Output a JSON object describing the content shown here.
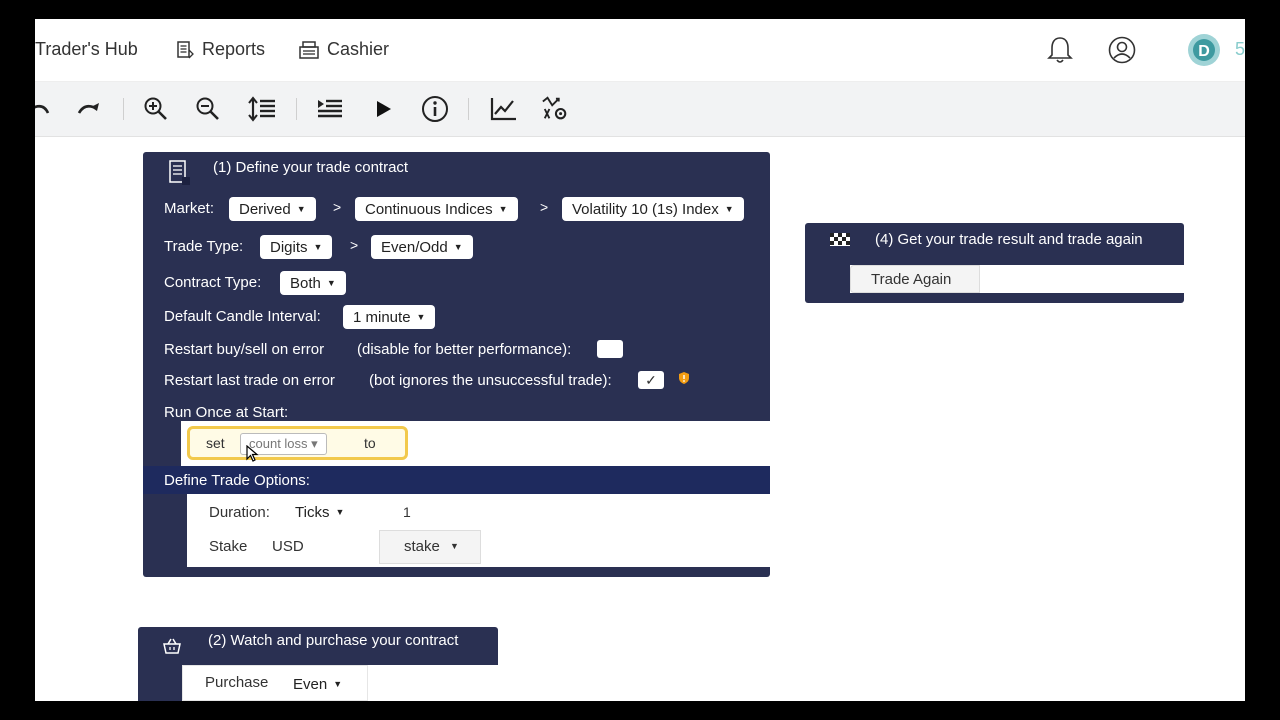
{
  "nav": {
    "traders_hub": "Trader's Hub",
    "reports": "Reports",
    "cashier": "Cashier",
    "edge_text": "5"
  },
  "toolbar": {
    "icons": [
      "undo-icon",
      "redo-icon",
      "zoom-in-icon",
      "zoom-out-icon",
      "sort-icon",
      "import-icon",
      "run-icon",
      "info-icon",
      "chart-icon",
      "trading-view-icon"
    ]
  },
  "block1": {
    "title": "(1) Define your trade contract",
    "market_label": "Market:",
    "market_value": "Derived",
    "submarket_value": "Continuous Indices",
    "symbol_value": "Volatility 10 (1s) Index",
    "sep": ">",
    "trade_type_label": "Trade Type:",
    "trade_type_value": "Digits",
    "trade_subtype_value": "Even/Odd",
    "contract_type_label": "Contract Type:",
    "contract_type_value": "Both",
    "candle_label": "Default Candle Interval:",
    "candle_value": "1 minute",
    "restart_buy_sell_label": "Restart buy/sell on error",
    "restart_buy_sell_note": "(disable for better performance):",
    "restart_last_label": "Restart last trade on error",
    "restart_last_note": "(bot ignores the unsuccessful trade):",
    "restart_last_check": "✓",
    "run_once_label": "Run Once at Start:",
    "set_block": {
      "set": "set",
      "variable": "count loss",
      "to": "to"
    },
    "trade_options_label": "Define Trade Options:",
    "duration_label": "Duration:",
    "duration_unit": "Ticks",
    "duration_value": "1",
    "stake_label": "Stake",
    "stake_currency": "USD",
    "stake_value": "stake"
  },
  "block2": {
    "title": "(2) Watch and purchase your contract",
    "purchase_label": "Purchase",
    "purchase_value": "Even"
  },
  "block4": {
    "title": "(4) Get your trade result and trade again",
    "trade_again": "Trade Again"
  },
  "colors": {
    "block": "#2a3052",
    "highlight": "#f2c94c"
  }
}
